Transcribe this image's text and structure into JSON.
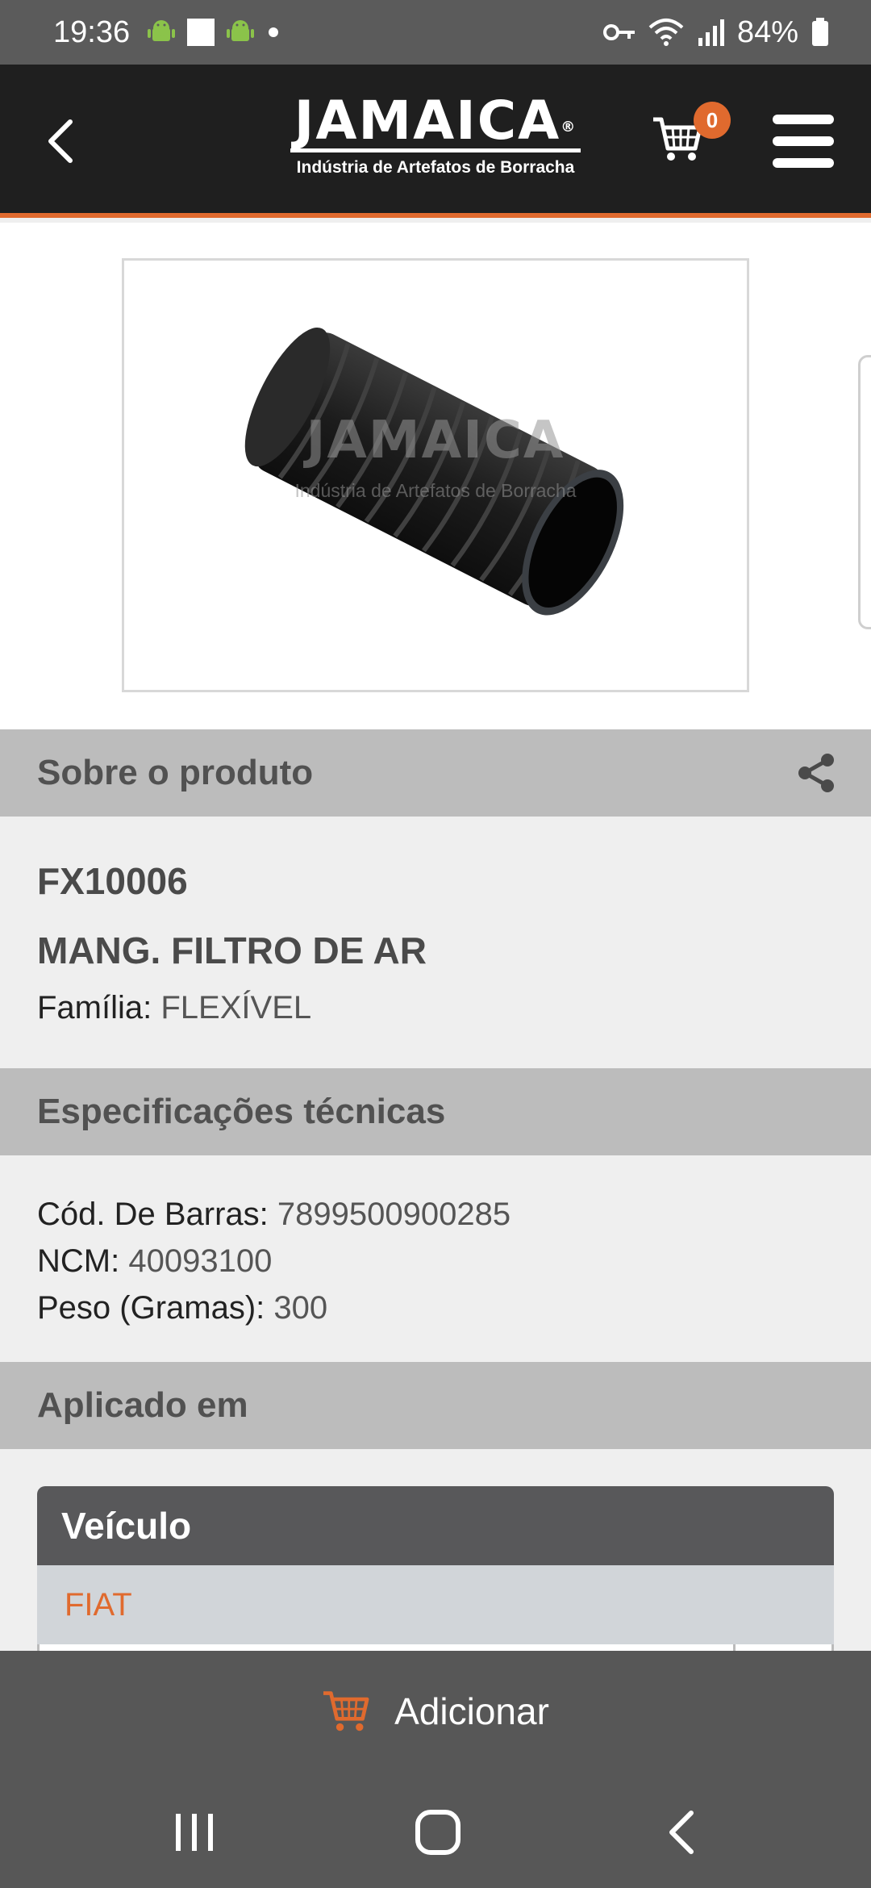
{
  "status_bar": {
    "time": "19:36",
    "battery": "84%",
    "icons": [
      "android-icon",
      "square-icon",
      "android-icon",
      "dot-icon",
      "vpn-key-icon",
      "wifi-icon",
      "signal-icon",
      "battery-icon"
    ]
  },
  "header": {
    "brand": "JAMAICA",
    "registered_mark": "®",
    "tagline": "Indústria de Artefatos de Borracha",
    "cart_count": "0",
    "accent_color": "#e06a2e",
    "background_color": "#1f1f1f"
  },
  "product_image": {
    "watermark_brand": "JAMAICA",
    "watermark_tagline": "Indústria de Artefatos de Borracha"
  },
  "about": {
    "heading": "Sobre o produto",
    "sku": "FX10006",
    "name": "MANG. FILTRO DE AR",
    "family_label": "Família:",
    "family_value": "FLEXÍVEL"
  },
  "specs": {
    "heading": "Especificações técnicas",
    "items": [
      {
        "label": "Cód. De Barras:",
        "value": "7899500900285"
      },
      {
        "label": "NCM:",
        "value": "40093100"
      },
      {
        "label": "Peso (Gramas):",
        "value": "300"
      }
    ]
  },
  "applied": {
    "heading": "Aplicado em",
    "table_header": "Veículo",
    "rows": [
      "FIAT"
    ]
  },
  "add_bar": {
    "label": "Adicionar"
  }
}
